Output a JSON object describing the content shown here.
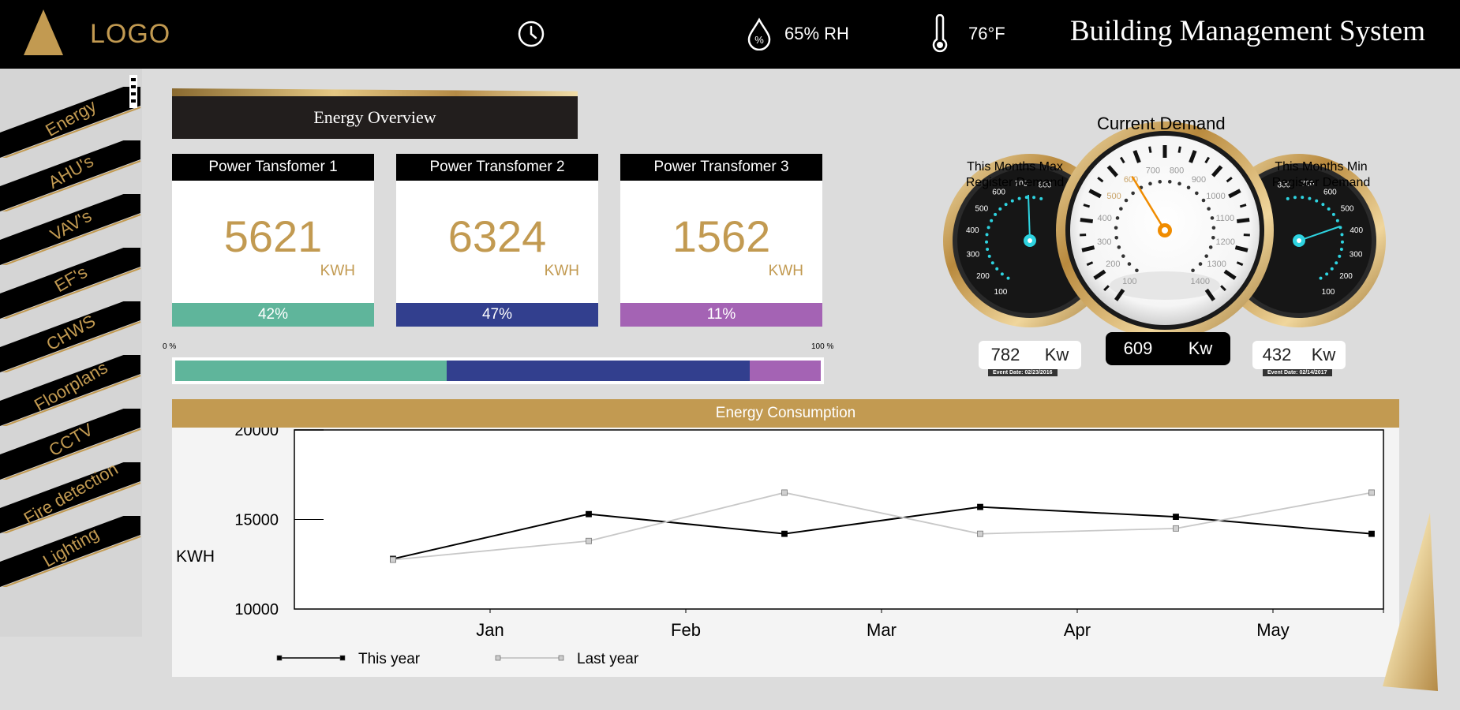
{
  "header": {
    "logo_text": "LOGO",
    "humidity": "65% RH",
    "temperature": "76°F",
    "title": "Building Management System",
    "icons": [
      "clock-icon",
      "humidity-icon",
      "thermometer-icon"
    ]
  },
  "sidebar": {
    "items": [
      {
        "label": "Energy"
      },
      {
        "label": "AHU's"
      },
      {
        "label": "VAV's"
      },
      {
        "label": "EF's"
      },
      {
        "label": "CHWS"
      },
      {
        "label": "Floorplans"
      },
      {
        "label": "CCTV"
      },
      {
        "label": "Fire detection"
      },
      {
        "label": "Lighting"
      }
    ]
  },
  "overview": {
    "title": "Energy Overview",
    "cards": [
      {
        "title": "Power Tansfomer 1",
        "value": "5621",
        "unit": "KWH",
        "percent": "42%",
        "color": "#5fb59b"
      },
      {
        "title": "Power Transfomer 2",
        "value": "6324",
        "unit": "KWH",
        "percent": "47%",
        "color": "#323f8e"
      },
      {
        "title": "Power Transfomer 3",
        "value": "1562",
        "unit": "KWH",
        "percent": "11%",
        "color": "#a463b4"
      }
    ],
    "scale_min": "0 %",
    "scale_max": "100 %",
    "share": [
      0.42,
      0.47,
      0.11
    ]
  },
  "demand": {
    "title": "Current Demand",
    "current_value": "609",
    "current_unit": "Kw",
    "current_ticks": [
      "100",
      "200",
      "300",
      "400",
      "500",
      "600",
      "700",
      "800",
      "900",
      "1000",
      "1100",
      "1200",
      "1300",
      "1400"
    ],
    "max": {
      "title_line1": "This Months Max",
      "title_line2": "Register Demand",
      "value": "782",
      "unit": "Kw",
      "event_date": "Event Date: 02/23/2016",
      "ticks": [
        "100",
        "200",
        "300",
        "400",
        "500",
        "600",
        "700",
        "800"
      ]
    },
    "min": {
      "title_line1": "This Months Min",
      "title_line2": "Register Demand",
      "value": "432",
      "unit": "Kw",
      "event_date": "Event Date: 02/14/2017",
      "ticks": [
        "800",
        "700",
        "600",
        "500",
        "400",
        "300",
        "200",
        "100"
      ]
    }
  },
  "consumption": {
    "title": "Energy Consumption"
  },
  "chart_data": {
    "type": "line",
    "title": "Energy Consumption",
    "ylabel": "KWH",
    "xlabel": "",
    "ylim": [
      10000,
      20000
    ],
    "yticks": [
      "20000",
      "15000",
      "10000"
    ],
    "categories": [
      "Jan",
      "Feb",
      "Mar",
      "Apr",
      "May"
    ],
    "x": [
      0,
      1,
      2,
      3,
      4,
      5
    ],
    "series": [
      {
        "name": "This year",
        "values": [
          12800,
          15300,
          14200,
          15700,
          15150,
          14200
        ],
        "color": "#000000"
      },
      {
        "name": "Last year",
        "values": [
          12750,
          13800,
          16500,
          14200,
          14500,
          16500
        ],
        "color": "#c8c8c8"
      }
    ],
    "grid": false,
    "legend": "bottom-left"
  }
}
